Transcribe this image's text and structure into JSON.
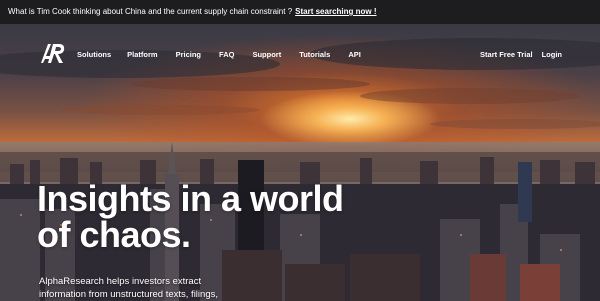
{
  "announcement": {
    "text": "What is Tim Cook thinking about China and the current supply chain constraint ?",
    "link_label": "Start searching now !"
  },
  "nav": {
    "logo_alt": "AR",
    "items": [
      "Solutions",
      "Platform",
      "Pricing",
      "FAQ",
      "Support",
      "Tutorials",
      "API"
    ],
    "right_items": [
      "Start Free Trial",
      "Login"
    ]
  },
  "hero": {
    "headline_line1": "Insights in a world",
    "headline_line2": "of chaos.",
    "subtext_line1": "AlphaResearch helps investors extract",
    "subtext_line2": "information from unstructured texts, filings,"
  },
  "colors": {
    "announce_bg": "#1d1d1f",
    "text": "#ffffff",
    "sunset": "#c9834c"
  },
  "icons": [
    "ar-logo-icon"
  ]
}
